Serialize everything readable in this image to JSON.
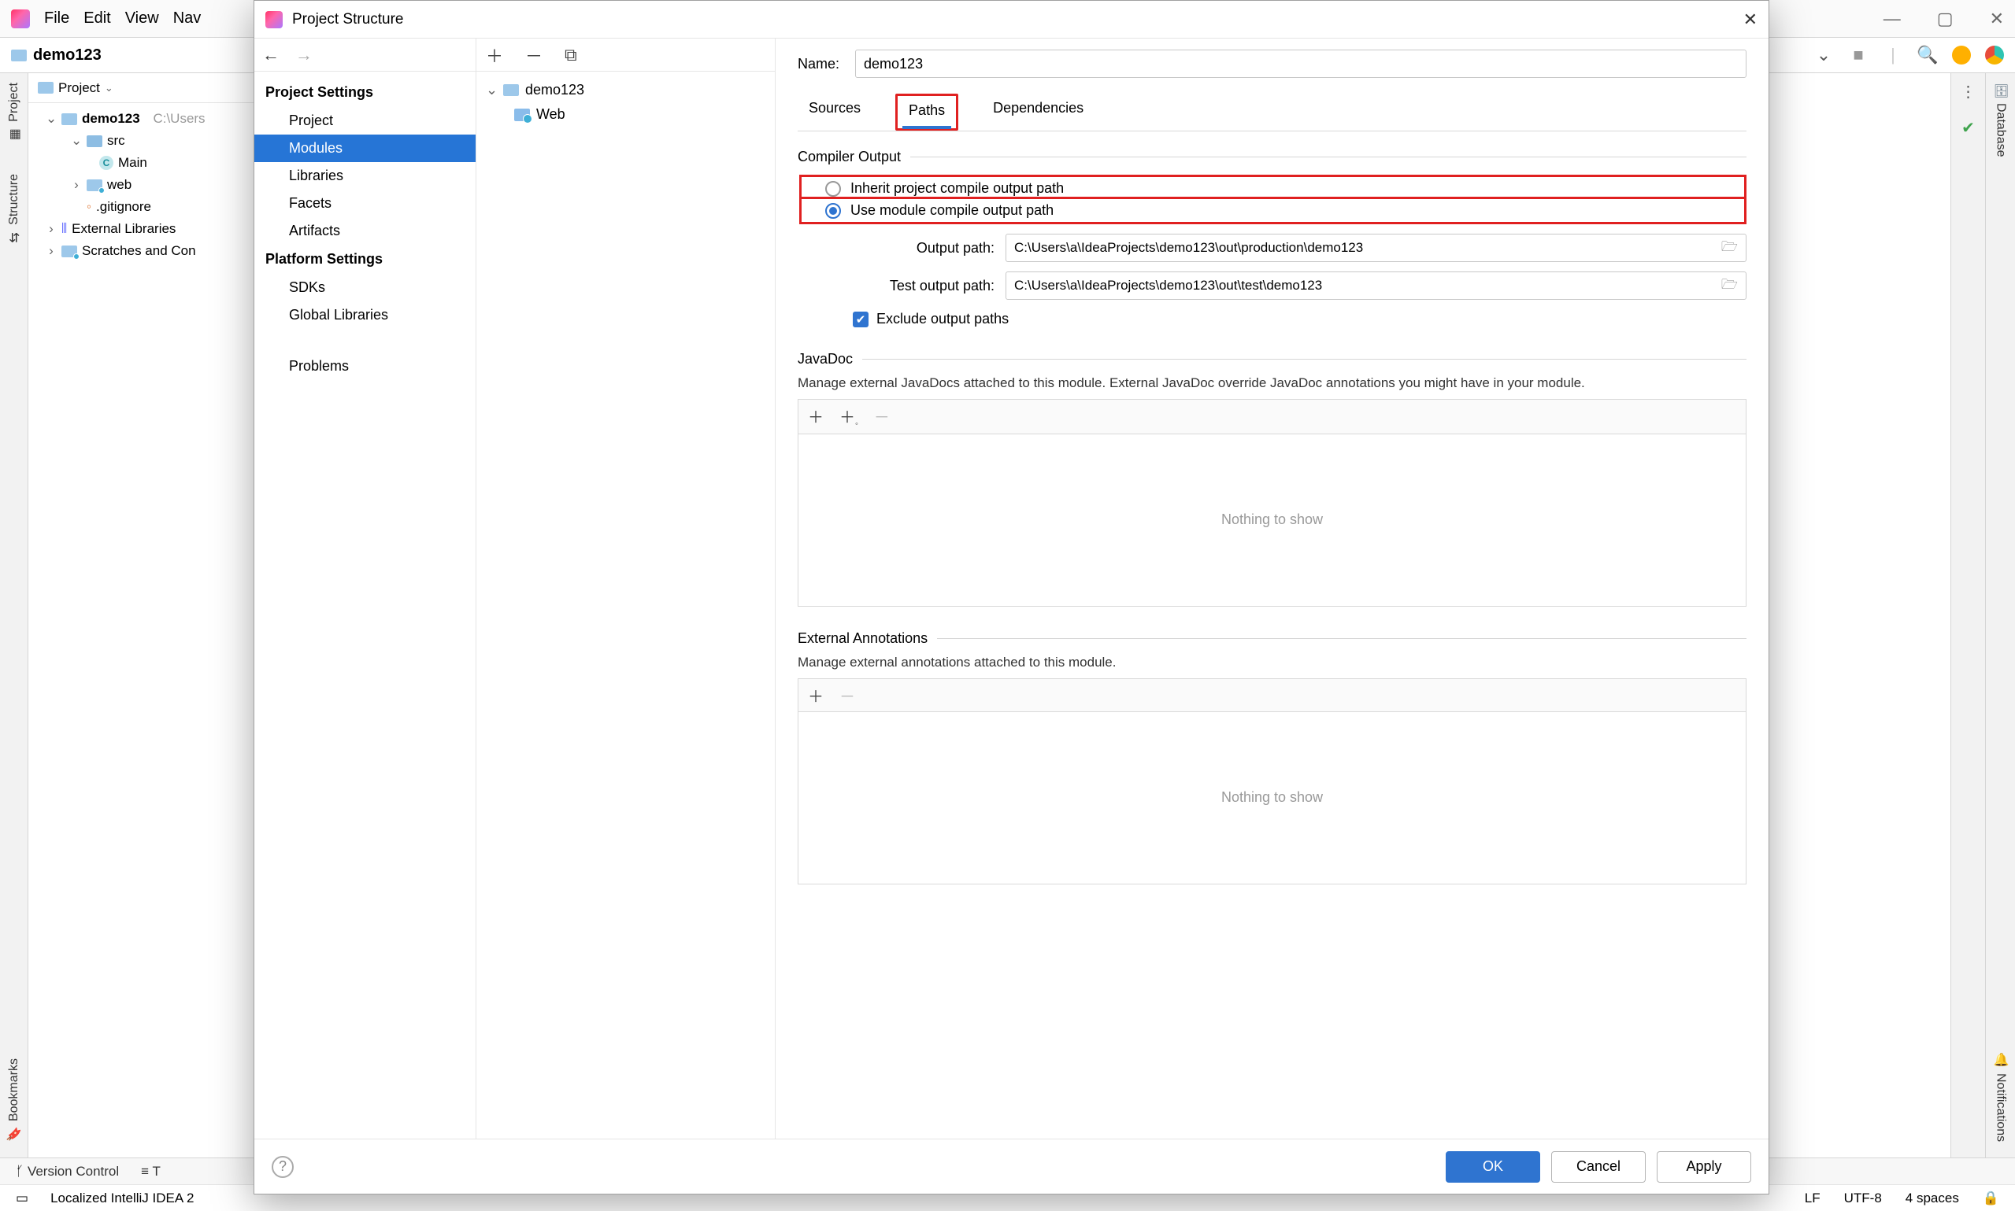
{
  "main": {
    "menu": {
      "file": "File",
      "edit": "Edit",
      "view": "View",
      "nav": "Nav"
    },
    "breadcrumb": {
      "project": "demo123"
    },
    "project_panel": {
      "title": "Project",
      "root": "demo123",
      "root_path": "C:\\Users",
      "src": "src",
      "main_class": "Main",
      "web": "web",
      "gitignore": ".gitignore",
      "ext_libs": "External Libraries",
      "scratches": "Scratches and Con"
    },
    "left_rail": {
      "project": "Project",
      "structure": "Structure",
      "bookmarks": "Bookmarks"
    },
    "right_rail": {
      "database": "Database",
      "notifications": "Notifications"
    },
    "status_tabs": {
      "version_control": "Version Control",
      "todo": "T"
    },
    "status2": {
      "msg": "Localized IntelliJ IDEA 2",
      "lf": "LF",
      "encoding": "UTF-8",
      "spaces": "4 spaces"
    }
  },
  "dialog": {
    "title": "Project Structure",
    "nav": {
      "project_settings_hdr": "Project Settings",
      "project": "Project",
      "modules": "Modules",
      "libraries": "Libraries",
      "facets": "Facets",
      "artifacts": "Artifacts",
      "platform_hdr": "Platform Settings",
      "sdks": "SDKs",
      "global_libs": "Global Libraries",
      "problems": "Problems"
    },
    "mid": {
      "module": "demo123",
      "web": "Web"
    },
    "content": {
      "name_label": "Name:",
      "name_value": "demo123",
      "tab_sources": "Sources",
      "tab_paths": "Paths",
      "tab_deps": "Dependencies",
      "compiler_output": "Compiler Output",
      "radio_inherit": "Inherit project compile output path",
      "radio_module": "Use module compile output path",
      "output_path_label": "Output path:",
      "output_path": "C:\\Users\\a\\IdeaProjects\\demo123\\out\\production\\demo123",
      "test_output_label": "Test output path:",
      "test_output": "C:\\Users\\a\\IdeaProjects\\demo123\\out\\test\\demo123",
      "exclude": "Exclude output paths",
      "javadoc_hdr": "JavaDoc",
      "javadoc_desc": "Manage external JavaDocs attached to this module. External JavaDoc override JavaDoc annotations you might have in your module.",
      "nothing": "Nothing to show",
      "ext_ann_hdr": "External Annotations",
      "ext_ann_desc": "Manage external annotations attached to this module."
    },
    "buttons": {
      "ok": "OK",
      "cancel": "Cancel",
      "apply": "Apply"
    }
  }
}
